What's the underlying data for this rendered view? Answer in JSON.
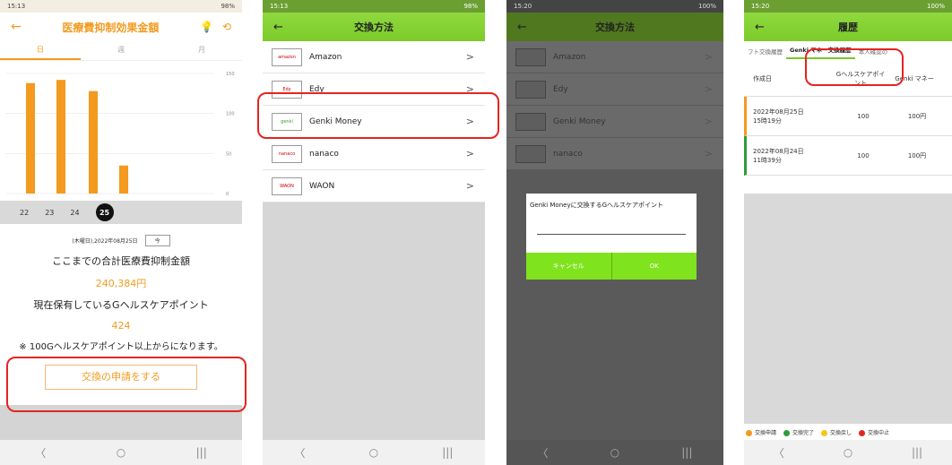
{
  "phone1": {
    "status_time": "15:13",
    "status_right": "98%",
    "title": "医療費抑制効果金額",
    "tabs": [
      "日",
      "週",
      "月"
    ],
    "y_ticks": [
      "150",
      "100",
      "50",
      "0"
    ],
    "days": [
      "22",
      "23",
      "24",
      "25"
    ],
    "date_text": "(木曜日),2022年08月25日",
    "today_button": "今",
    "total_label": "ここまでの合計医療費抑制金額",
    "total_value": "240,384円",
    "points_label": "現在保有しているGヘルスケアポイント",
    "points_value": "424",
    "note": "※ 100Gヘルスケアポイント以上からになります。",
    "apply_button": "交換の申請をする"
  },
  "chart_data": {
    "type": "bar",
    "categories": [
      "22",
      "23",
      "24",
      "25"
    ],
    "values": [
      138,
      142,
      128,
      35
    ],
    "ylim": [
      0,
      150
    ],
    "color": "#f39a1f"
  },
  "phone2": {
    "status_time": "15:13",
    "status_right": "98%",
    "title": "交換方法",
    "items": [
      {
        "name": "Amazon",
        "logo": "amazon"
      },
      {
        "name": "Edy",
        "logo": "Edy"
      },
      {
        "name": "Genki Money",
        "logo": "genki"
      },
      {
        "name": "nanaco",
        "logo": "nanaco"
      },
      {
        "name": "WAON",
        "logo": "WAON"
      }
    ]
  },
  "phone3": {
    "status_time": "15:20",
    "status_right": "100%",
    "title": "交換方法",
    "items": [
      "Amazon",
      "Edy",
      "Genki Money",
      "nanaco"
    ],
    "dialog_message": "Genki Moneyに交換するGヘルスケアポイント",
    "cancel": "キャンセル",
    "ok": "OK"
  },
  "phone4": {
    "status_time": "15:20",
    "status_right": "100%",
    "title": "履歴",
    "tabs": [
      "フト交換履歴",
      "Genki マネー交換履歴",
      "本人確認の"
    ],
    "headers": [
      "作成日",
      "Gヘルスケアポイント",
      "Genki マネー"
    ],
    "rows": [
      {
        "date": "2022年08月25日",
        "time": "15時19分",
        "points": "100",
        "money": "100円"
      },
      {
        "date": "2022年08月24日",
        "time": "11時39分",
        "points": "100",
        "money": "100円"
      }
    ],
    "legend": [
      {
        "label": "交換申請",
        "color": "#f39a1f"
      },
      {
        "label": "交換完了",
        "color": "#2e9b3a"
      },
      {
        "label": "交換戻し",
        "color": "#f6c61a"
      },
      {
        "label": "交換中止",
        "color": "#e52420"
      }
    ]
  },
  "nav": [
    "〈",
    "○",
    "|||"
  ]
}
